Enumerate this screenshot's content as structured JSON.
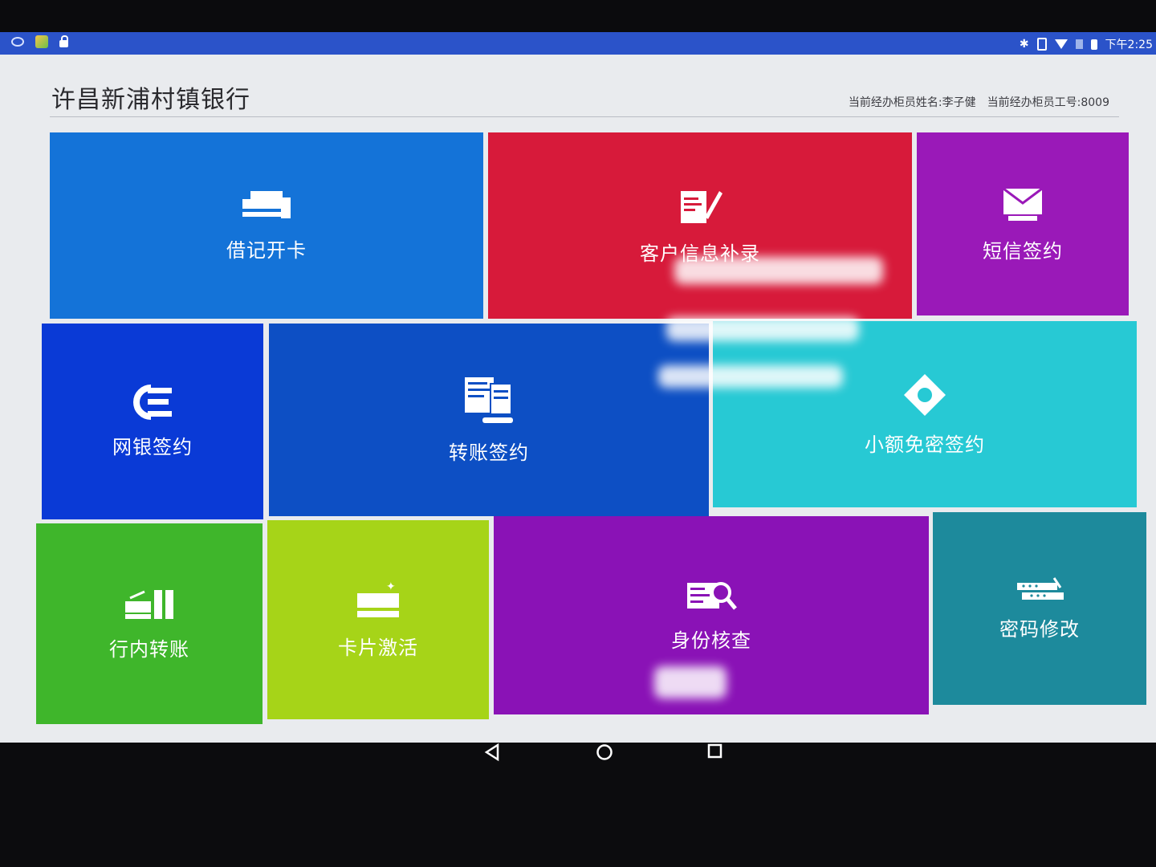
{
  "status_bar": {
    "time": "下午2:25",
    "icons": [
      "app-icon",
      "app-store-icon",
      "lock-icon",
      "bluetooth-icon",
      "vibrate-icon",
      "wifi-icon",
      "sim-icon",
      "battery-icon"
    ]
  },
  "header": {
    "bank_name": "许昌新浦村镇银行",
    "teller_name": "当前经办柜员姓名:李子健",
    "teller_id": "当前经办柜员工号:8009"
  },
  "tiles": [
    {
      "label": "借记开卡",
      "color": "#1473d8",
      "icon": "cards-icon"
    },
    {
      "label": "客户信息补录",
      "color": "#d71a3a",
      "icon": "document-edit-icon"
    },
    {
      "label": "短信签约",
      "color": "#9a19b8",
      "icon": "envelope-icon"
    },
    {
      "label": "网银签约",
      "color": "#0a3ad6",
      "icon": "ebank-logo-icon"
    },
    {
      "label": "转账签约",
      "color": "#0d4fc4",
      "icon": "transfer-doc-icon"
    },
    {
      "label": "小额免密签约",
      "color": "#27c9d4",
      "icon": "diamond-icon"
    },
    {
      "label": "行内转账",
      "color": "#3fb62b",
      "icon": "internal-transfer-icon"
    },
    {
      "label": "卡片激活",
      "color": "#a6d418",
      "icon": "card-activate-icon"
    },
    {
      "label": "身份核查",
      "color": "#8a12b6",
      "icon": "id-check-icon"
    },
    {
      "label": "密码修改",
      "color": "#1d8a9c",
      "icon": "password-icon"
    }
  ],
  "navbar": {
    "buttons": [
      "back-button",
      "home-button",
      "recents-button"
    ]
  }
}
